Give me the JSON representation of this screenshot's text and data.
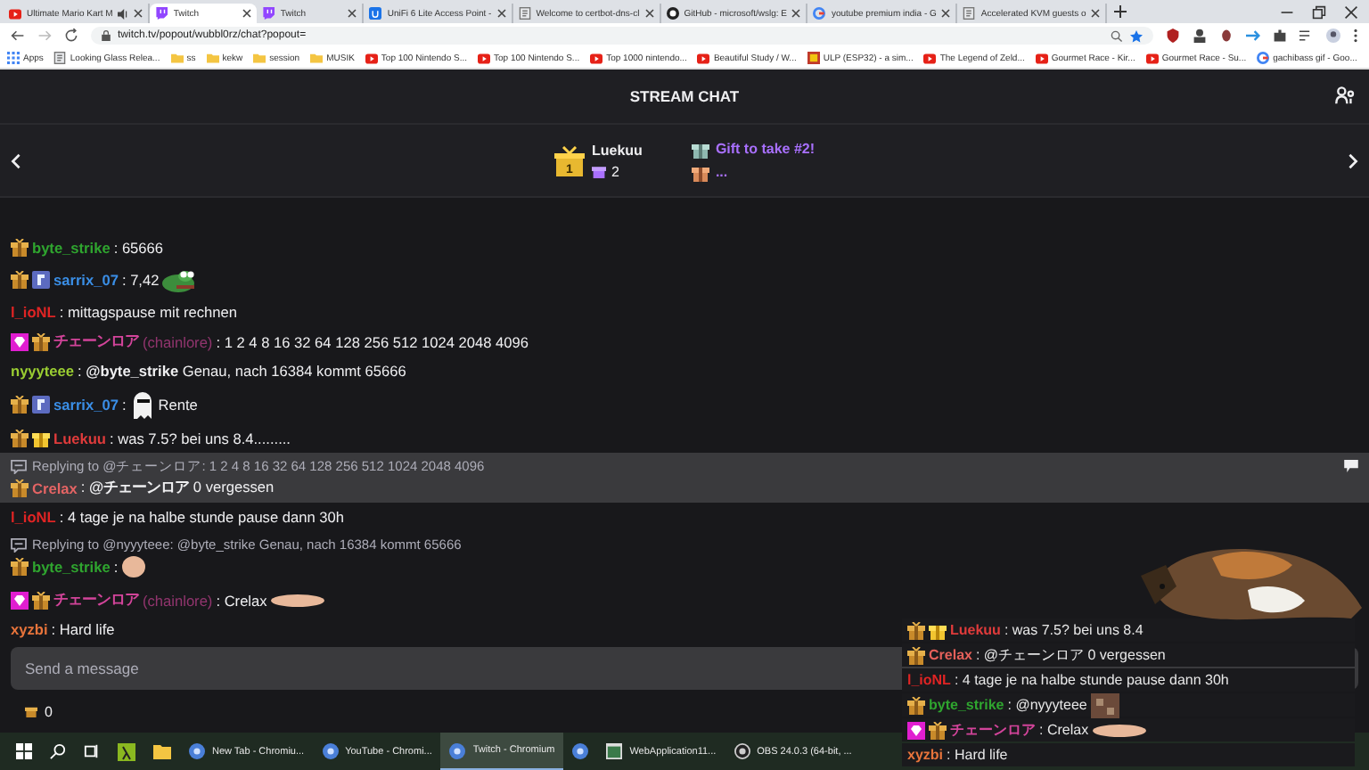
{
  "browser": {
    "tabs": [
      {
        "title": "Ultimate Mario Kart M",
        "kind": "video",
        "audio": true,
        "selected": false
      },
      {
        "title": "Twitch",
        "kind": "stream",
        "audio": false,
        "selected": true
      },
      {
        "title": "Twitch",
        "kind": "stream",
        "audio": false,
        "selected": false
      },
      {
        "title": "UniFi 6 Lite Access Point -",
        "kind": "letter",
        "audio": false,
        "selected": false
      },
      {
        "title": "Welcome to certbot-dns-cl",
        "kind": "page",
        "audio": false,
        "selected": false
      },
      {
        "title": "GitHub - microsoft/wslg: E",
        "kind": "circle",
        "audio": false,
        "selected": false
      },
      {
        "title": "youtube premium india - G",
        "kind": "search",
        "audio": false,
        "selected": false
      },
      {
        "title": "Accelerated KVM guests o",
        "kind": "page",
        "audio": false,
        "selected": false
      }
    ],
    "url": "twitch.tv/popout/wubbl0rz/chat?popout=",
    "bookmarks": [
      {
        "label": "Apps",
        "kind": "grid"
      },
      {
        "label": "Looking Glass Relea...",
        "kind": "page"
      },
      {
        "label": "ss",
        "kind": "folder"
      },
      {
        "label": "kekw",
        "kind": "folder"
      },
      {
        "label": "session",
        "kind": "folder"
      },
      {
        "label": "MUSIK",
        "kind": "folder"
      },
      {
        "label": "Top 100 Nintendo S...",
        "kind": "video"
      },
      {
        "label": "Top 100 Nintendo S...",
        "kind": "video"
      },
      {
        "label": "Top 1000 nintendo...",
        "kind": "video"
      },
      {
        "label": "Beautiful Study / W...",
        "kind": "video"
      },
      {
        "label": "ULP (ESP32) - a sim...",
        "kind": "image"
      },
      {
        "label": "The Legend of Zeld...",
        "kind": "video"
      },
      {
        "label": "Gourmet Race - Kir...",
        "kind": "video"
      },
      {
        "label": "Gourmet Race - Su...",
        "kind": "video"
      },
      {
        "label": "gachibass gif - Goo...",
        "kind": "search"
      }
    ]
  },
  "chat": {
    "header": "STREAM CHAT",
    "gift_bar": {
      "rank": "1",
      "leader": "Luekuu",
      "count": "2",
      "title": "Gift to take #2!",
      "subtitle": "..."
    },
    "messages": [
      {
        "badges": [
          {
            "kind": "tier"
          }
        ],
        "user": "byte_strike",
        "color": "#2fa52f",
        "text": ": 65666",
        "highlighted": false
      },
      {
        "badges": [
          {
            "kind": "tier"
          },
          {
            "kind": "founder"
          }
        ],
        "user": "sarrix_07",
        "color": "#3a8ee6",
        "text": ": 7,42",
        "emote": {
          "kind": "frog"
        },
        "highlighted": false
      },
      {
        "user": "l_ioNL",
        "color": "#e02424",
        "text": ": mittagspause mit rechnen",
        "highlighted": false
      },
      {
        "badges": [
          {
            "kind": "gem"
          },
          {
            "kind": "tier"
          }
        ],
        "user": "チェーンロア",
        "alt": "(chainlore)",
        "color": "#d2449a",
        "text": ": 1 2 4 8 16 32 64 128 256 512 1024 2048 4096",
        "highlighted": false
      },
      {
        "user": "nyyyteee",
        "color": "#9acd32",
        "text": ": **@byte_strike** Genau, nach 16384 kommt 65666",
        "highlighted": false
      },
      {
        "badges": [
          {
            "kind": "tier"
          },
          {
            "kind": "founder"
          }
        ],
        "user": "sarrix_07",
        "color": "#3a8ee6",
        "text": ":",
        "emote": {
          "kind": "ghost"
        },
        "after": "Rente",
        "highlighted": false
      },
      {
        "badges": [
          {
            "kind": "tier"
          },
          {
            "kind": "gift"
          }
        ],
        "user": "Luekuu",
        "color": "#e03b3b",
        "text": ": was 7.5? bei uns 8.4.........",
        "highlighted": false
      },
      {
        "reply": "Replying to @チェーンロア: 1 2 4 8 16 32 64 128 256 512 1024 2048 4096",
        "badges": [
          {
            "kind": "tier"
          }
        ],
        "user": "Crelax",
        "color": "#e46464",
        "text": ": **@チェーンロア** 0 vergessen",
        "highlighted": true
      },
      {
        "user": "l_ioNL",
        "color": "#e02424",
        "text": ": 4 tage je na halbe stunde pause dann 30h",
        "highlighted": false
      },
      {
        "reply": "Replying to @nyyyteee: @byte_strike Genau, nach 16384 kommt 65666",
        "badges": [
          {
            "kind": "tier"
          }
        ],
        "user": "byte_strike",
        "color": "#2fa52f",
        "text": ":",
        "emote": {
          "kind": "blob"
        },
        "highlighted": false
      },
      {
        "badges": [
          {
            "kind": "gem"
          },
          {
            "kind": "tier"
          }
        ],
        "user": "チェーンロア",
        "alt": "(chainlore)",
        "color": "#d2449a",
        "text": ": Crelax",
        "emote": {
          "kind": "flat"
        },
        "highlighted": false
      },
      {
        "user": "xyzbi",
        "color": "#e8743b",
        "text": ": Hard life",
        "highlighted": false
      }
    ],
    "input": {
      "placeholder": "Send a message"
    },
    "points": "0"
  },
  "overlay": {
    "messages": [
      {
        "badges": [
          {
            "kind": "tier"
          },
          {
            "kind": "gift"
          }
        ],
        "user": "Luekuu",
        "color": "#e03b3b",
        "text": ": was 7.5? bei uns 8.4"
      },
      {
        "badges": [
          {
            "kind": "tier"
          }
        ],
        "user": "Crelax",
        "color": "#e4605a",
        "text": ": @チェーンロア 0 vergessen"
      },
      {
        "user": "l_ioNL",
        "color": "#e02424",
        "text": ": 4 tage je na halbe stunde pause dann 30h"
      },
      {
        "badges": [
          {
            "kind": "tier"
          }
        ],
        "user": "byte_strike",
        "color": "#2fa52f",
        "text": ": @nyyyteee",
        "emote": {
          "kind": "pixel"
        }
      },
      {
        "badges": [
          {
            "kind": "gem"
          },
          {
            "kind": "tier"
          }
        ],
        "user": "チェーンロア",
        "color": "#d2449a",
        "text": ": Crelax",
        "emote": {
          "kind": "flat"
        }
      },
      {
        "user": "xyzbi",
        "color": "#e8743b",
        "text": ": Hard life"
      }
    ]
  },
  "taskbar": {
    "items": [
      {
        "kind": "start",
        "selected": false
      },
      {
        "kind": "search",
        "selected": false
      },
      {
        "kind": "taskview",
        "selected": false
      },
      {
        "kind": "app",
        "selected": false
      },
      {
        "kind": "folder",
        "selected": false
      },
      {
        "kind": "browser",
        "label": "New Tab - Chromiu...",
        "selected": false
      },
      {
        "kind": "browser",
        "label": "YouTube - Chromi...",
        "selected": false
      },
      {
        "kind": "browser",
        "label": "Twitch - Chromium",
        "selected": true
      },
      {
        "kind": "browser",
        "selected": false
      },
      {
        "kind": "window",
        "label": "WebApplication11...",
        "selected": false
      },
      {
        "kind": "ring",
        "label": "OBS 24.0.3 (64-bit, ...",
        "selected": false
      }
    ]
  }
}
